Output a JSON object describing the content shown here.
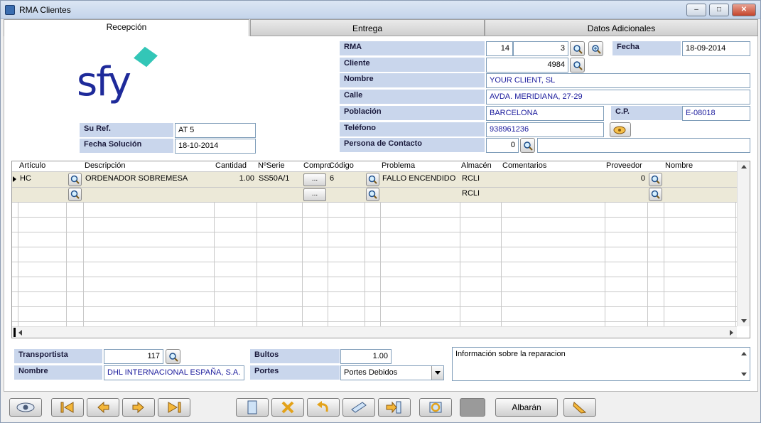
{
  "window": {
    "title": "RMA Clientes",
    "minimize": "–",
    "maximize": "□",
    "close": "✕"
  },
  "tabs": [
    {
      "label": "Recepción"
    },
    {
      "label": "Entrega"
    },
    {
      "label": "Datos Adicionales"
    }
  ],
  "logo": {
    "text": "sfy",
    "color": "#1e2a9a",
    "accent": "#33c6b7"
  },
  "header": {
    "rma_label": "RMA",
    "rma_a": "14",
    "rma_b": "3",
    "fecha_label": "Fecha",
    "fecha_value": "18-09-2014",
    "cliente_label": "Cliente",
    "cliente_value": "4984",
    "nombre_label": "Nombre",
    "nombre_value": "YOUR CLIENT, SL",
    "calle_label": "Calle",
    "calle_value": "AVDA. MERIDIANA, 27-29",
    "poblacion_label": "Población",
    "poblacion_value": "BARCELONA",
    "cp_label": "C.P.",
    "cp_value": "E-08018",
    "telefono_label": "Teléfono",
    "telefono_value": "938961236",
    "contacto_label": "Persona de Contacto",
    "contacto_value": "0",
    "suref_label": "Su Ref.",
    "suref_value": "AT 5",
    "fechasol_label": "Fecha Solución",
    "fechasol_value": "18-10-2014"
  },
  "grid": {
    "columns": [
      "Artículo",
      "Descripción",
      "Cantidad",
      "NºSerie",
      "Compro",
      "Código",
      "Problema",
      "Almacén",
      "Comentarios",
      "Proveedor",
      "Nombre"
    ],
    "rows": [
      {
        "articulo": "HC",
        "descripcion": "ORDENADOR SOBREMESA",
        "cantidad": "1.00",
        "serie": "SS50A/1",
        "compro": "...",
        "codigo": "6",
        "problema": "FALLO ENCENDIDO",
        "almacen": "RCLI",
        "comentarios": "",
        "proveedor": "0",
        "nombre": ""
      },
      {
        "articulo": "",
        "descripcion": "",
        "cantidad": "",
        "serie": "",
        "compro": "...",
        "codigo": "",
        "problema": "",
        "almacen": "RCLI",
        "comentarios": "",
        "proveedor": "",
        "nombre": ""
      }
    ]
  },
  "footer": {
    "transportista_label": "Transportista",
    "transportista_value": "117",
    "nombre_label": "Nombre",
    "nombre_value": "DHL INTERNACIONAL ESPAÑA, S.A.",
    "bultos_label": "Bultos",
    "bultos_value": "1.00",
    "portes_label": "Portes",
    "portes_value": "Portes Debidos",
    "notes": "Información sobre la reparacion"
  },
  "toolbar": {
    "albaran_label": "Albarán"
  },
  "colors": {
    "label_bg": "#c9d6ec",
    "field_text": "#1a1a9c",
    "title_bg": "#c4d4ea"
  }
}
